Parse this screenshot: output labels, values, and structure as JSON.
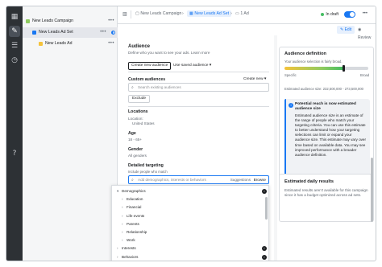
{
  "topbar": {
    "crumb_campaign": "New Leads Campaign",
    "crumb_adset": "New Leads Ad Set",
    "crumb_ad": "1 Ad",
    "status": "In draft",
    "edit_label": "Edit",
    "review_label": "Review"
  },
  "tree": {
    "campaign": "New Leads Campaign",
    "adset": "New Leads Ad Set",
    "ad": "New Leads Ad"
  },
  "audience": {
    "title": "Audience",
    "subtitle": "Define who you want to see your ads. Learn more",
    "tabs": [
      "Create new audience",
      "Use saved audience ▾"
    ],
    "custom_label": "Custom audiences",
    "create_new": "Create new ▾",
    "custom_placeholder": "Search existing audiences",
    "exclude_label": "Exclude",
    "locations_label": "Locations",
    "location_sub": "Location:",
    "location_value": "United States",
    "age_label": "Age",
    "age_value": "18 - 65+",
    "gender_label": "Gender",
    "gender_value": "All genders",
    "detailed_label": "Detailed targeting",
    "include_label": "Include people who match",
    "detailed_placeholder": "Add demographics, interests or behaviors",
    "suggestions_label": "Suggestions",
    "browse_label": "Browse"
  },
  "dropdown": {
    "items": [
      {
        "name": "Demographics",
        "level": 0,
        "open": true
      },
      {
        "name": "Education",
        "level": 1
      },
      {
        "name": "Financial",
        "level": 1
      },
      {
        "name": "Life events",
        "level": 1
      },
      {
        "name": "Parents",
        "level": 1
      },
      {
        "name": "Relationship",
        "level": 1
      },
      {
        "name": "Work",
        "level": 1
      },
      {
        "name": "Interests",
        "level": 0
      },
      {
        "name": "Behaviors",
        "level": 0
      }
    ]
  },
  "definition": {
    "title": "Audience definition",
    "desc": "Your audience selection is fairly broad.",
    "specific": "Specific",
    "broad": "Broad",
    "meter_position": 0.7,
    "estimated": "Estimated audience size: 232,500,000 - 273,500,000",
    "note_title": "Potential reach is now estimated audience size",
    "note_body": "Estimated audience size is an estimate of the range of people who match your targeting criteria. You can use this estimate to better understand how your targeting selections can limit or expand your audience size. This estimate may vary over time based on available data. You may see improved performance with a broader audience definition."
  },
  "daily": {
    "title": "Estimated daily results",
    "body": "Estimated results aren't available for this campaign since it has a budget optimized across ad sets."
  }
}
